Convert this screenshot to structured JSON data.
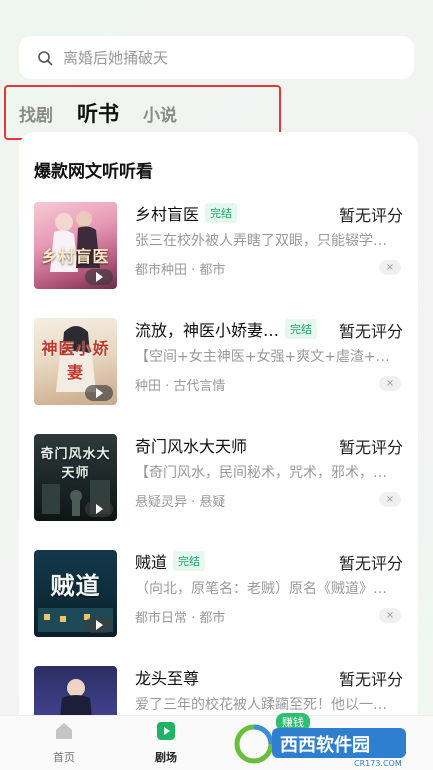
{
  "search": {
    "placeholder": "离婚后她捅破天"
  },
  "tabs": [
    {
      "label": "找剧"
    },
    {
      "label": "听书"
    },
    {
      "label": "小说"
    }
  ],
  "section": {
    "title": "爆款网文听听看"
  },
  "books": [
    {
      "title": "乡村盲医",
      "badge": "完结",
      "score": "暂无评分",
      "desc": "张三在校外被人弄瞎了双眼，只能辍学…",
      "meta": "都市种田 · 都市",
      "cover_text": "乡村盲医"
    },
    {
      "title": "流放，神医小娇妻…",
      "badge": "完结",
      "score": "暂无评分",
      "desc": "【空间+女主神医+女强+爽文+虐渣+发…",
      "meta": "种田 · 古代言情",
      "cover_text": "神医小娇妻"
    },
    {
      "title": "奇门风水大天师",
      "badge": "",
      "score": "暂无评分",
      "desc": "【奇门风水，民间秘术，咒术，邪术，…",
      "meta": "悬疑灵异 · 悬疑",
      "cover_text": "奇门风水大天师"
    },
    {
      "title": "贼道",
      "badge": "完结",
      "score": "暂无评分",
      "desc": "（向北，原笔名：老贼）原名《贼道》…",
      "meta": "都市日常 · 都市",
      "cover_text": "贼道"
    },
    {
      "title": "龙头至尊",
      "badge": "",
      "score": "暂无评分",
      "desc": "爱了三年的校花被人蹂躏至死！他以一…",
      "meta": "",
      "cover_text": ""
    }
  ],
  "bottom_nav": [
    {
      "label": "首页"
    },
    {
      "label": "剧场"
    }
  ],
  "earn_badge": "赚钱",
  "close_glyph": "×",
  "watermark": {
    "brand": "西西软件园",
    "domain": "CR173.COM"
  }
}
